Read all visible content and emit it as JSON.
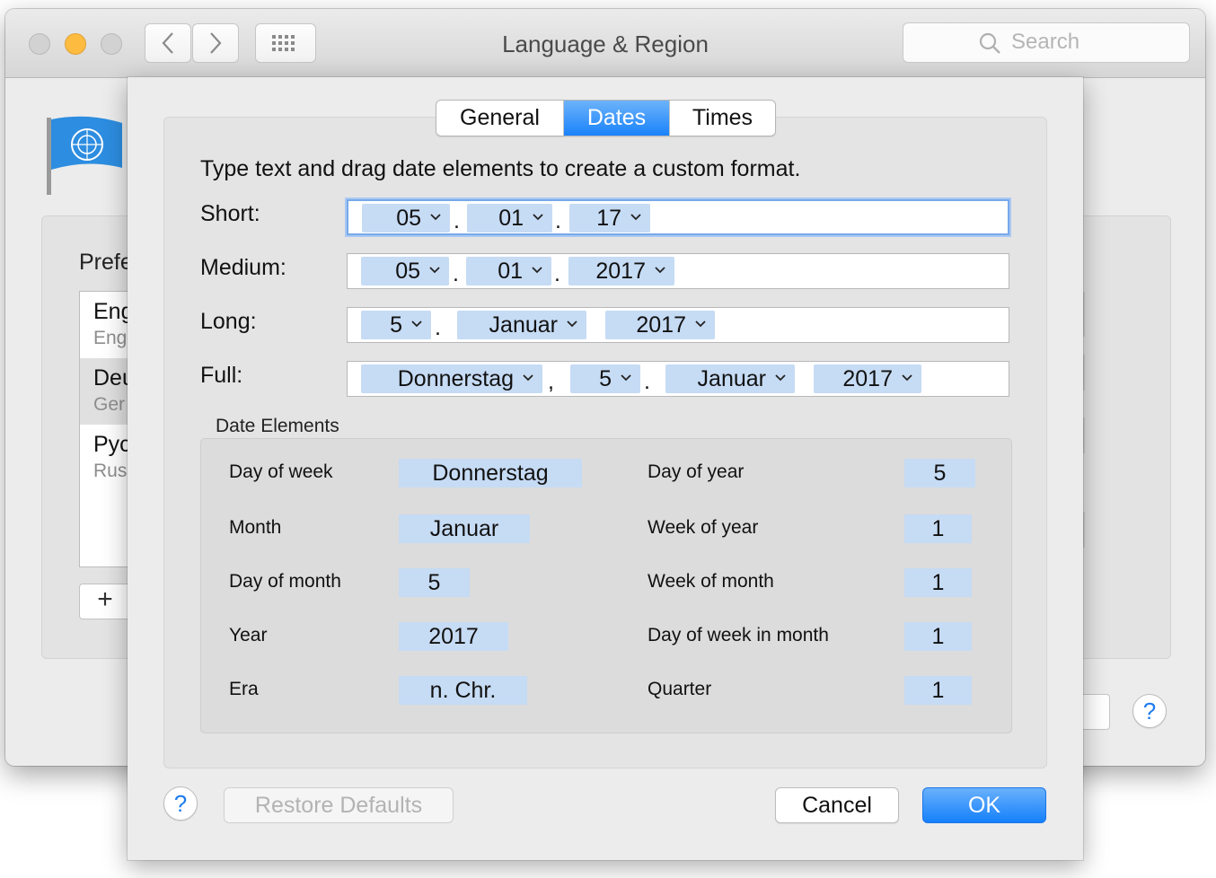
{
  "window": {
    "title": "Language & Region"
  },
  "search": {
    "placeholder": "Search"
  },
  "background": {
    "preferred_label": "Prefe",
    "languages": [
      {
        "name": "Eng",
        "sub": "Eng"
      },
      {
        "name": "Deu",
        "sub": "Ger"
      },
      {
        "name": "Pyc",
        "sub": "Rus"
      }
    ],
    "add_button": "+",
    "help": "?"
  },
  "sheet": {
    "tabs": {
      "general": "General",
      "dates": "Dates",
      "times": "Times"
    },
    "active_tab": "Dates",
    "instruction": "Type text and drag date elements to create a custom format.",
    "formats": {
      "short": {
        "label": "Short:",
        "tokens": [
          "05",
          "01",
          "17"
        ],
        "separators": [
          ".",
          "."
        ]
      },
      "medium": {
        "label": "Medium:",
        "tokens": [
          "05",
          "01",
          "2017"
        ],
        "separators": [
          ".",
          "."
        ]
      },
      "long": {
        "label": "Long:",
        "tokens": [
          "5",
          "Januar",
          "2017"
        ],
        "separators": [
          ".",
          ""
        ]
      },
      "full": {
        "label": "Full:",
        "tokens": [
          "Donnerstag",
          "5",
          "Januar",
          "2017"
        ],
        "separators": [
          ",",
          ".",
          ""
        ]
      }
    },
    "date_elements": {
      "title": "Date Elements",
      "left": [
        {
          "label": "Day of week",
          "value": "Donnerstag"
        },
        {
          "label": "Month",
          "value": "Januar"
        },
        {
          "label": "Day of month",
          "value": "5"
        },
        {
          "label": "Year",
          "value": "2017"
        },
        {
          "label": "Era",
          "value": "n. Chr."
        }
      ],
      "right": [
        {
          "label": "Day of year",
          "value": "5"
        },
        {
          "label": "Week of year",
          "value": "1"
        },
        {
          "label": "Week of month",
          "value": "1"
        },
        {
          "label": "Day of week in month",
          "value": "1"
        },
        {
          "label": "Quarter",
          "value": "1"
        }
      ]
    },
    "buttons": {
      "help": "?",
      "restore": "Restore Defaults",
      "cancel": "Cancel",
      "ok": "OK"
    }
  },
  "colors": {
    "accent": "#1a82fb",
    "token_bg": "#c6dbf4",
    "window_bg": "#ececec"
  }
}
